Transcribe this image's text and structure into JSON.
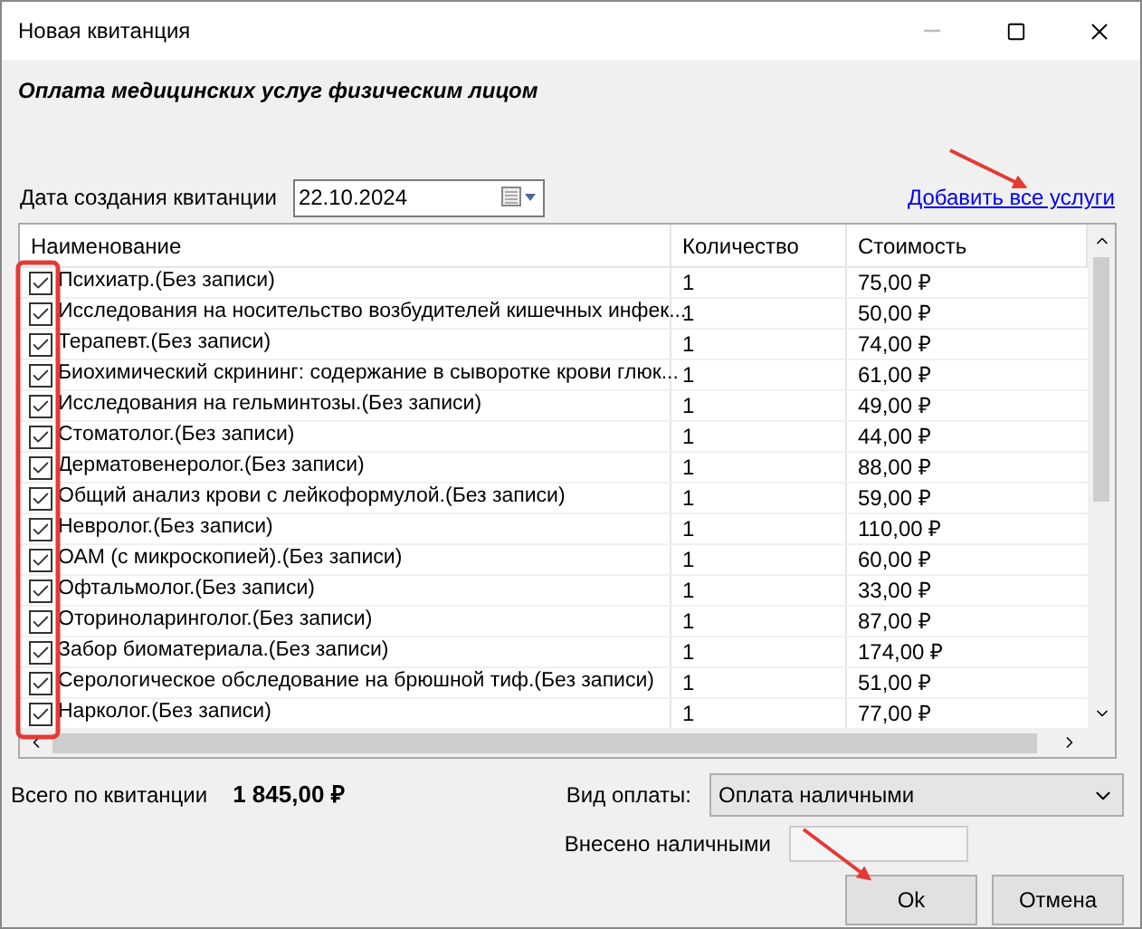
{
  "window": {
    "title": "Новая квитанция"
  },
  "subtitle": "Оплата медицинских услуг физическим лицом",
  "date": {
    "label": "Дата создания квитанции",
    "value": "22.10.2024"
  },
  "add_all_link": "Добавить все услуги",
  "table": {
    "columns": [
      "Наименование",
      "Количество",
      "Стоимость"
    ],
    "rows": [
      {
        "checked": true,
        "name": "Психиатр.(Без записи)",
        "qty": "1",
        "cost": "75,00 ₽"
      },
      {
        "checked": true,
        "name": "Исследования на носительство возбудителей кишечных инфек...",
        "qty": "1",
        "cost": "50,00 ₽"
      },
      {
        "checked": true,
        "name": "Терапевт.(Без записи)",
        "qty": "1",
        "cost": "74,00 ₽"
      },
      {
        "checked": true,
        "name": "Биохимический скрининг: содержание в сыворотке крови глюк...",
        "qty": "1",
        "cost": "61,00 ₽"
      },
      {
        "checked": true,
        "name": "Исследования на гельминтозы.(Без записи)",
        "qty": "1",
        "cost": "49,00 ₽"
      },
      {
        "checked": true,
        "name": "Стоматолог.(Без записи)",
        "qty": "1",
        "cost": "44,00 ₽"
      },
      {
        "checked": true,
        "name": "Дерматовенеролог.(Без записи)",
        "qty": "1",
        "cost": "88,00 ₽"
      },
      {
        "checked": true,
        "name": "Общий анализ крови с лейкоформулой.(Без записи)",
        "qty": "1",
        "cost": "59,00 ₽"
      },
      {
        "checked": true,
        "name": "Невролог.(Без записи)",
        "qty": "1",
        "cost": "110,00 ₽"
      },
      {
        "checked": true,
        "name": "ОАМ (с микроскопией).(Без записи)",
        "qty": "1",
        "cost": "60,00 ₽"
      },
      {
        "checked": true,
        "name": "Офтальмолог.(Без записи)",
        "qty": "1",
        "cost": "33,00 ₽"
      },
      {
        "checked": true,
        "name": "Оториноларинголог.(Без записи)",
        "qty": "1",
        "cost": "87,00 ₽"
      },
      {
        "checked": true,
        "name": "Забор биоматериала.(Без записи)",
        "qty": "1",
        "cost": "174,00 ₽"
      },
      {
        "checked": true,
        "name": "Серологическое обследование на брюшной тиф.(Без записи)",
        "qty": "1",
        "cost": "51,00 ₽"
      },
      {
        "checked": true,
        "name": "Нарколог.(Без записи)",
        "qty": "1",
        "cost": "77,00 ₽"
      }
    ]
  },
  "total": {
    "label": "Всего по квитанции",
    "value": "1 845,00 ₽"
  },
  "payment": {
    "label": "Вид оплаты:",
    "value": "Оплата наличными"
  },
  "cash": {
    "label": "Внесено наличными"
  },
  "buttons": [
    "Ok",
    "Отмена"
  ]
}
